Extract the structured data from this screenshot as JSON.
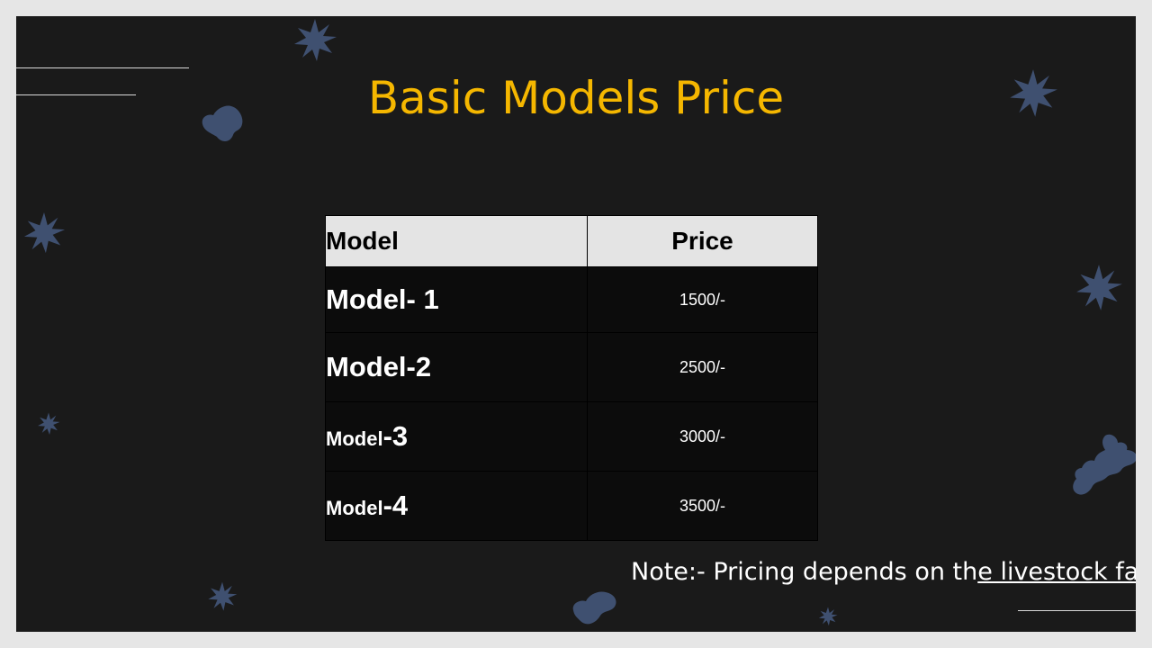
{
  "slide": {
    "title": "Basic Models Price",
    "table": {
      "headers": {
        "model": "Model",
        "price": "Price"
      },
      "rows": [
        {
          "model_text": "Model- 1",
          "price": "1500/-"
        },
        {
          "model_text": "Model-2",
          "price": "2500/-"
        },
        {
          "model_prefix": "Model",
          "model_suffix": "-3",
          "price": "3000/-"
        },
        {
          "model_prefix": "Model",
          "model_suffix": "-4",
          "price": "3500/-"
        }
      ]
    },
    "note": {
      "plain": "Note:- Pricing depends on th",
      "underlined": "e livestock farm"
    }
  },
  "colors": {
    "background": "#1a1a1a",
    "title": "#f5b700",
    "header_bg": "#e4e4e4",
    "decoration": "#3f5070"
  },
  "icons": [
    "star-burst-decoration",
    "blob-decoration"
  ]
}
